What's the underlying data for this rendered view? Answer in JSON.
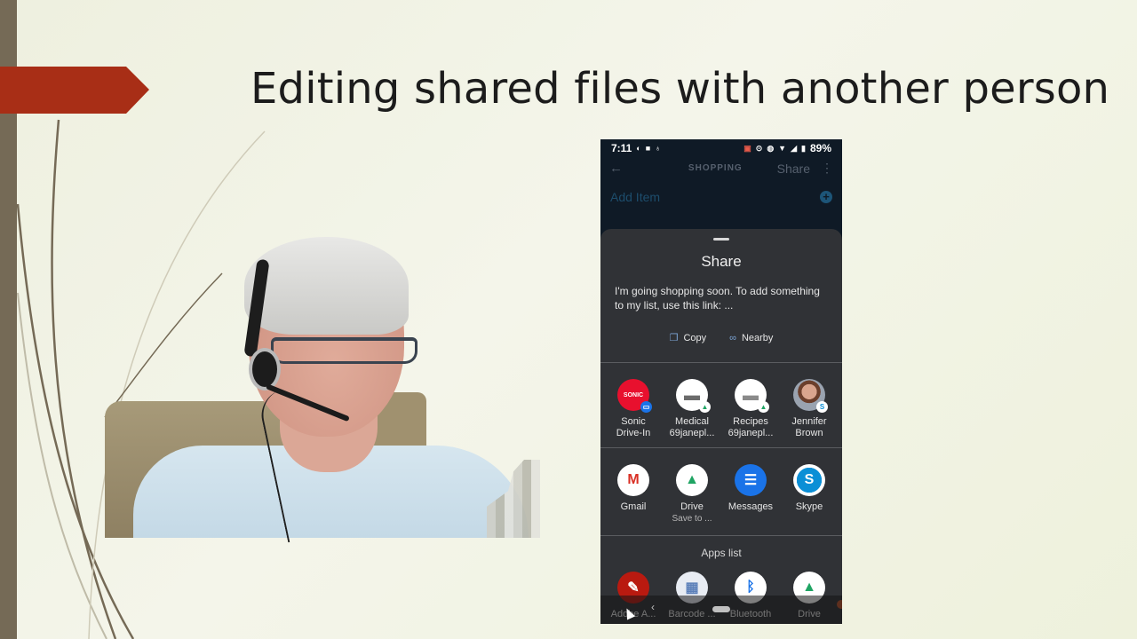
{
  "slide": {
    "title": "Editing shared files with another person",
    "accent_color": "#a82e16",
    "sidebar_color": "#756a56"
  },
  "phone": {
    "status_bar": {
      "time": "7:11",
      "left_icons": [
        "app-notification-icon",
        "video-icon",
        "lightbulb-icon"
      ],
      "right_icons": [
        "cast-icon",
        "location-icon",
        "vibrate-icon",
        "wifi-icon",
        "signal-icon",
        "battery-icon"
      ],
      "battery": "89%"
    },
    "app_bar": {
      "back_icon": "←",
      "title": "SHOPPING",
      "share_label": "Share",
      "more_icon": "⋮"
    },
    "add_item": {
      "label": "Add Item",
      "icon": "+"
    },
    "share_sheet": {
      "title": "Share",
      "preview_text": "I'm going shopping soon. To add something to my list, use this link: ...",
      "actions": [
        {
          "label": "Copy",
          "icon": "❐"
        },
        {
          "label": "Nearby",
          "icon": "∞"
        }
      ],
      "direct_targets": [
        {
          "name": "Sonic",
          "sub": "Drive-In",
          "icon": "SONIC",
          "bg": "#e8102e",
          "badge": "messages"
        },
        {
          "name": "Medical",
          "sub": "69janepl...",
          "icon": "folder-shared",
          "bg": "#ffffff",
          "badge": "drive"
        },
        {
          "name": "Recipes",
          "sub": "69janepl...",
          "icon": "folder",
          "bg": "#ffffff",
          "badge": "drive"
        },
        {
          "name": "Jennifer",
          "sub": "Brown",
          "icon": "contact-photo",
          "bg": "#9aa3b0",
          "badge": "skype"
        }
      ],
      "apps": [
        {
          "name": "Gmail",
          "sub": "",
          "icon": "M",
          "bg": "#ffffff",
          "color": "#d93025"
        },
        {
          "name": "Drive",
          "sub": "Save to ...",
          "icon": "▲",
          "bg": "#ffffff",
          "color": "#1fa463"
        },
        {
          "name": "Messages",
          "sub": "",
          "icon": "☰",
          "bg": "#1a73e8",
          "color": "#ffffff"
        },
        {
          "name": "Skype",
          "sub": "",
          "icon": "S",
          "bg": "#ffffff",
          "color": "#0b8fd6"
        }
      ],
      "apps_list_label": "Apps list",
      "apps_list": [
        {
          "name": "Adobe A...",
          "icon": "✎",
          "bg": "#b91a10",
          "color": "#ffffff"
        },
        {
          "name": "Barcode ...",
          "icon": "▦",
          "bg": "#e8ecf3",
          "color": "#5b7fb9"
        },
        {
          "name": "Bluetooth",
          "icon": "ᛒ",
          "bg": "#ffffff",
          "color": "#1a73e8"
        },
        {
          "name": "Drive",
          "icon": "▲",
          "bg": "#ffffff",
          "color": "#1fa463"
        }
      ]
    }
  }
}
